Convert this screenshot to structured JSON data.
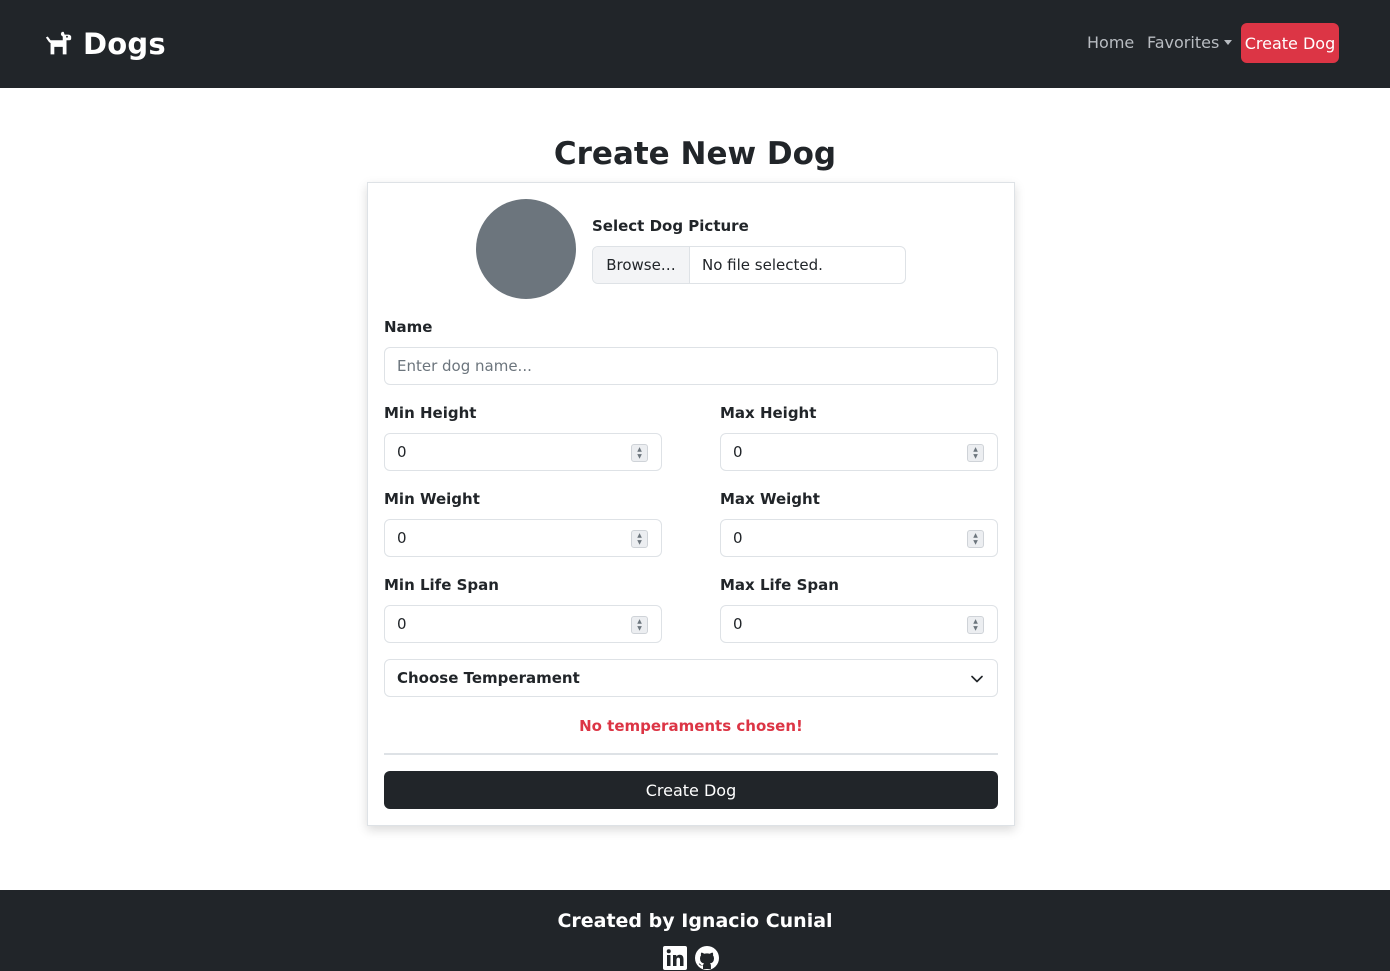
{
  "navbar": {
    "brand": "Dogs",
    "brand_icon": "dog-icon",
    "links": {
      "home": "Home",
      "favorites": "Favorites",
      "create": "Create Dog"
    }
  },
  "page": {
    "title": "Create New Dog"
  },
  "form": {
    "picture": {
      "label": "Select Dog Picture",
      "browse_label": "Browse…",
      "file_status": "No file selected."
    },
    "name": {
      "label": "Name",
      "placeholder": "Enter dog name..."
    },
    "fields": {
      "min_height": {
        "label": "Min Height",
        "value": "0"
      },
      "max_height": {
        "label": "Max Height",
        "value": "0"
      },
      "min_weight": {
        "label": "Min Weight",
        "value": "0"
      },
      "max_weight": {
        "label": "Max Weight",
        "value": "0"
      },
      "min_life_span": {
        "label": "Min Life Span",
        "value": "0"
      },
      "max_life_span": {
        "label": "Max Life Span",
        "value": "0"
      }
    },
    "temperament": {
      "selected": "Choose Temperament",
      "error": "No temperaments chosen!"
    },
    "submit_label": "Create Dog"
  },
  "footer": {
    "credit": "Created by Ignacio Cunial",
    "icons": [
      "linkedin-icon",
      "github-icon"
    ]
  },
  "colors": {
    "navbar_bg": "#212529",
    "accent_red": "#dc3545",
    "avatar_gray": "#6c757d"
  }
}
